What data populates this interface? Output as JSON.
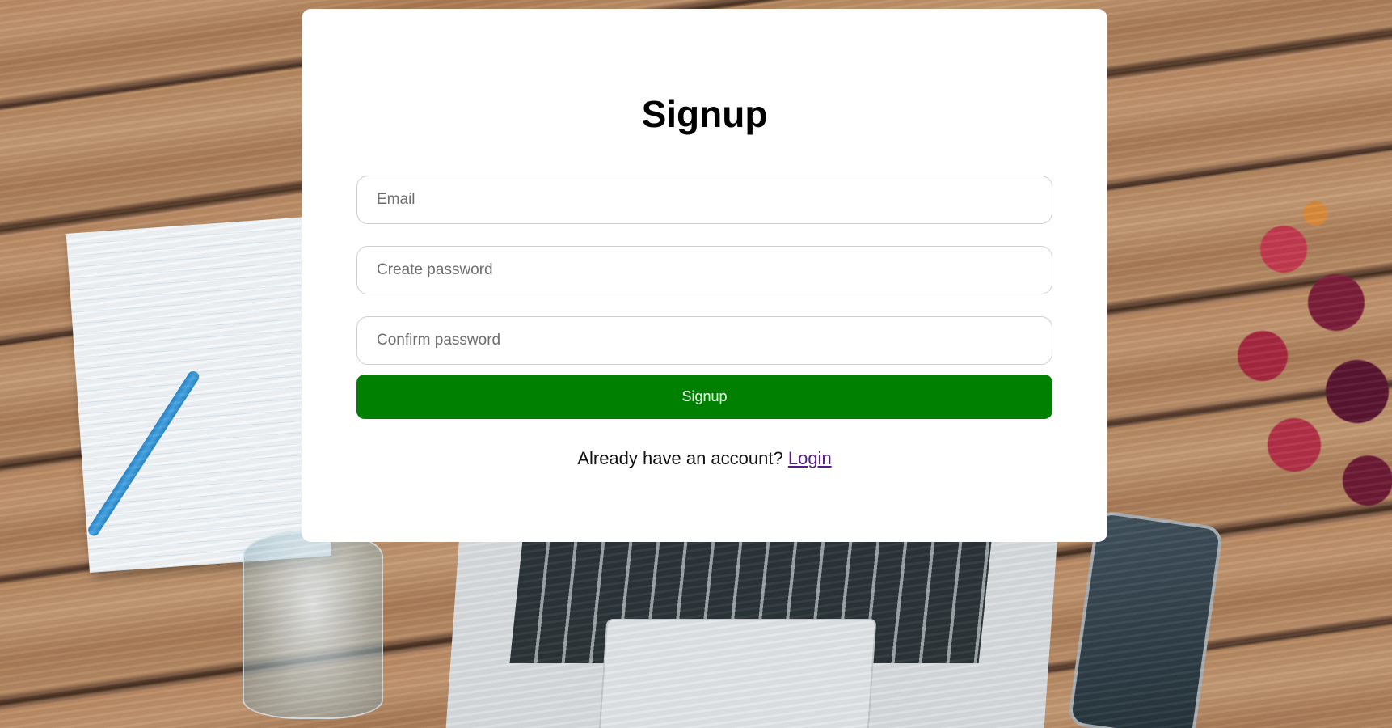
{
  "signup_form": {
    "title": "Signup",
    "email_placeholder": "Email",
    "create_password_placeholder": "Create password",
    "confirm_password_placeholder": "Confirm password",
    "submit_label": "Signup",
    "login_prompt": "Already have an account?",
    "login_link": "Login"
  },
  "colors": {
    "button": "#008000",
    "link": "#551a8b"
  }
}
